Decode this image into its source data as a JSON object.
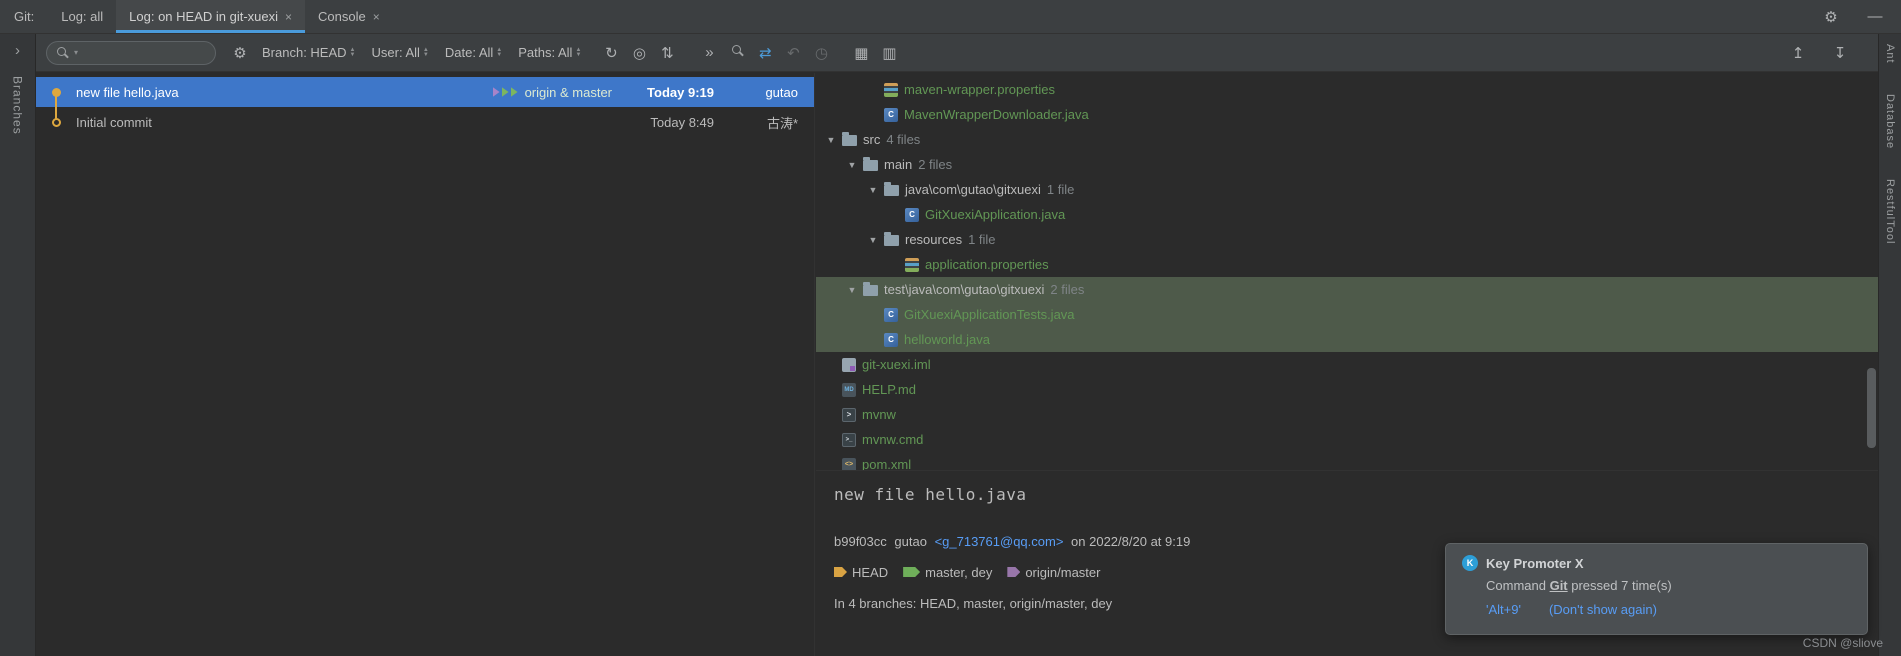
{
  "colors": {
    "accent_blue": "#4a9bdb",
    "selection_blue": "#3e77c9",
    "selection_green": "#4e5a4a",
    "added_file_green": "#629755",
    "link_blue": "#589df6",
    "graph_yellow": "#dea83f"
  },
  "tabbar": {
    "git_label": "Git:",
    "tabs": [
      {
        "label": "Log: all",
        "close": "",
        "active": false
      },
      {
        "label": "Log: on HEAD in git-xuexi",
        "close": "×",
        "active": true
      },
      {
        "label": "Console",
        "close": "×",
        "active": false
      }
    ],
    "gear_icon": "⚙",
    "minimize_icon": "—"
  },
  "left_stripe": {
    "expand_icon": "›",
    "branches_label": "Branches"
  },
  "right_stripe": {
    "items": [
      "Ant",
      "Database",
      "RestfulTool"
    ]
  },
  "toolbar": {
    "search_value": "",
    "filters": [
      {
        "label": "Branch: HEAD"
      },
      {
        "label": "User: All"
      },
      {
        "label": "Date: All"
      },
      {
        "label": "Paths: All"
      }
    ],
    "icons": {
      "refresh": "↻",
      "intellisort": "◎",
      "collapse_branches": "⇅",
      "more": "»",
      "navigate": "⇄",
      "undo": "↶",
      "recent": "◷",
      "grid": "▦",
      "details_view": "▥",
      "collapse_all": "↥",
      "expand_all": "↧"
    }
  },
  "commits": [
    {
      "message": "new file hello.java",
      "refs": {
        "label": "origin & master"
      },
      "time": "Today 9:19",
      "author": "gutao",
      "selected": true,
      "node": "filled"
    },
    {
      "message": "Initial commit",
      "refs": null,
      "time": "Today 8:49",
      "author": "古涛*",
      "selected": false,
      "node": "hollow"
    }
  ],
  "file_tree": {
    "rows": [
      {
        "kind": "file",
        "icon": "properties",
        "label": "maven-wrapper.properties",
        "depth": 2,
        "selected": false
      },
      {
        "kind": "file",
        "icon": "class",
        "label": "MavenWrapperDownloader.java",
        "depth": 2,
        "selected": false
      },
      {
        "kind": "folder",
        "label": "src",
        "count": "4 files",
        "depth": 0,
        "selected": false
      },
      {
        "kind": "folder",
        "label": "main",
        "count": "2 files",
        "depth": 1,
        "selected": false
      },
      {
        "kind": "folder",
        "label": "java\\com\\gutao\\gitxuexi",
        "count": "1 file",
        "depth": 2,
        "selected": false
      },
      {
        "kind": "file",
        "icon": "class",
        "label": "GitXuexiApplication.java",
        "depth": 3,
        "selected": false
      },
      {
        "kind": "folder",
        "label": "resources",
        "count": "1 file",
        "depth": 2,
        "selected": false
      },
      {
        "kind": "file",
        "icon": "properties",
        "label": "application.properties",
        "depth": 3,
        "selected": false
      },
      {
        "kind": "folder",
        "label": "test\\java\\com\\gutao\\gitxuexi",
        "count": "2 files",
        "depth": 1,
        "selected": true
      },
      {
        "kind": "file",
        "icon": "class",
        "label": "GitXuexiApplicationTests.java",
        "depth": 2,
        "selected": true
      },
      {
        "kind": "file",
        "icon": "class",
        "label": "helloworld.java",
        "depth": 2,
        "selected": true
      },
      {
        "kind": "file",
        "icon": "iml",
        "label": "git-xuexi.iml",
        "depth": 0,
        "selected": false
      },
      {
        "kind": "file",
        "icon": "md",
        "label": "HELP.md",
        "depth": 0,
        "selected": false
      },
      {
        "kind": "file",
        "icon": "shell",
        "label": "mvnw",
        "depth": 0,
        "selected": false
      },
      {
        "kind": "file",
        "icon": "cmd",
        "label": "mvnw.cmd",
        "depth": 0,
        "selected": false
      },
      {
        "kind": "file",
        "icon": "xml",
        "label": "pom.xml",
        "depth": 0,
        "selected": false
      }
    ]
  },
  "details": {
    "title": "new file hello.java",
    "hash": "b99f03cc",
    "author": "gutao",
    "email": "<g_713761@qq.com>",
    "date_suffix": "on 2022/8/20 at 9:19",
    "tags": [
      {
        "color": "yellow",
        "label": "HEAD",
        "double": false
      },
      {
        "color": "green",
        "label": "master, dey",
        "double": true
      },
      {
        "color": "purple",
        "label": "origin/master",
        "double": false
      }
    ],
    "branches_line": "In 4 branches: HEAD, master, origin/master, dey"
  },
  "notification": {
    "title": "Key Promoter X",
    "icon_letter": "K",
    "body_prefix": "Command ",
    "command": "Git",
    "body_suffix": " pressed 7 time(s)",
    "shortcut_link": "'Alt+9'",
    "dismiss_link": "(Don't show again)"
  },
  "watermark": "CSDN @sliove"
}
